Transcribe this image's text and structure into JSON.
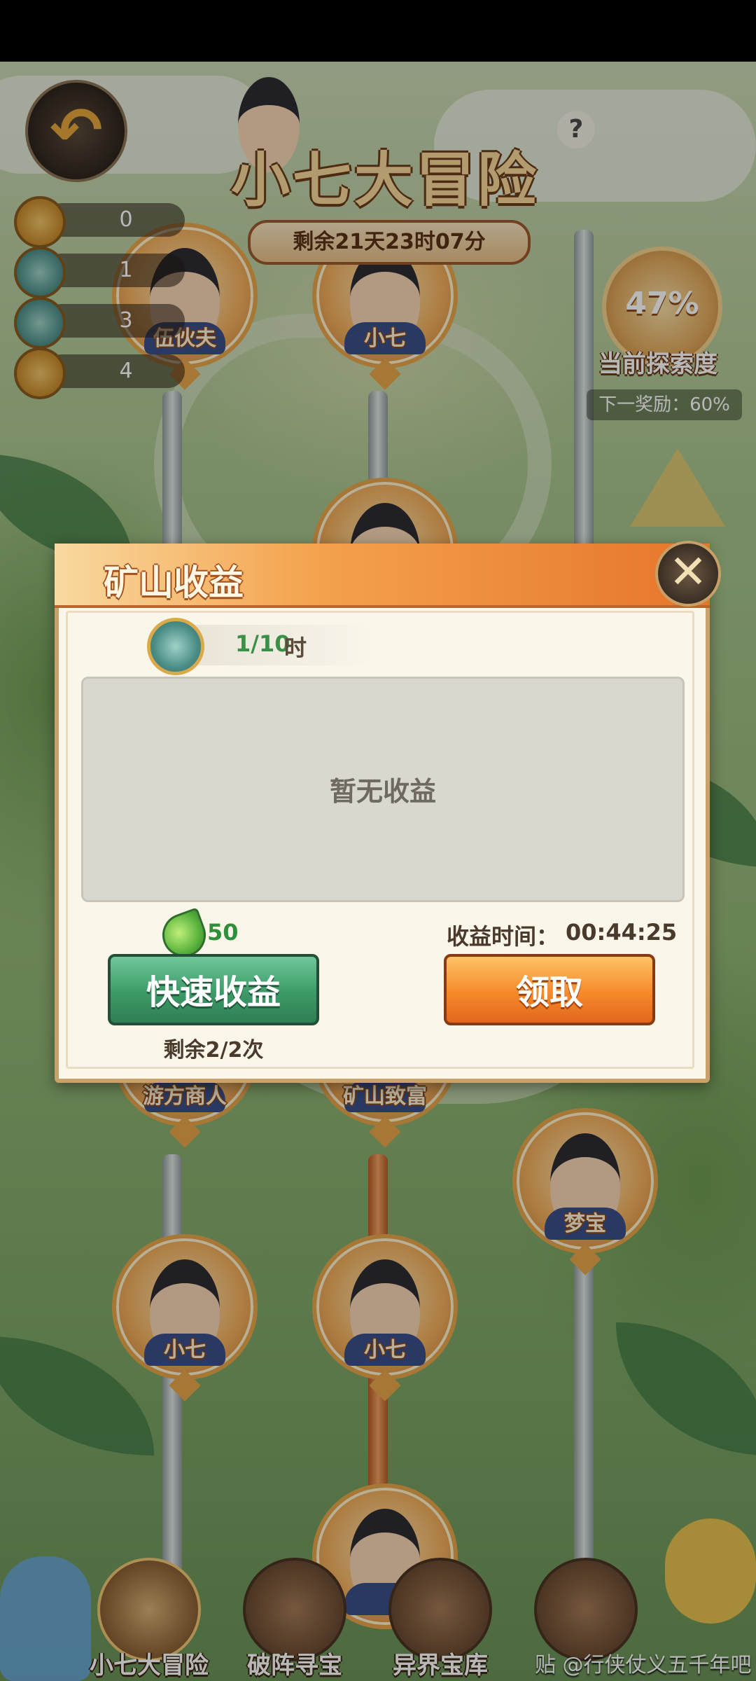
{
  "game": {
    "title": "小七大冒险",
    "timer": "剩余21天23时07分",
    "help_symbol": "?",
    "back_symbol": "↶"
  },
  "currencies": [
    {
      "icon": "phoenix-coin-icon",
      "value": "0"
    },
    {
      "icon": "dragon-coin-icon",
      "value": "1"
    },
    {
      "icon": "dragon-coin-icon",
      "value": "3"
    },
    {
      "icon": "swirl-coin-icon",
      "value": "4"
    }
  ],
  "exploration": {
    "percent": "47%",
    "label": "当前探索度",
    "next_reward": "下一奖励：60%"
  },
  "map_nodes": [
    {
      "label": "伍伙夫"
    },
    {
      "label": "小七"
    },
    {
      "label": ""
    },
    {
      "label": "游方商人"
    },
    {
      "label": "矿山致富"
    },
    {
      "label": "梦宝"
    },
    {
      "label": "小七"
    },
    {
      "label": "小七"
    },
    {
      "label": ""
    }
  ],
  "dialog": {
    "title": "矿山收益",
    "close_symbol": "✕",
    "hours_count": "1/10",
    "hours_unit": "时",
    "empty_text": "暂无收益",
    "cost_value": "50",
    "income_time_label": "收益时间：",
    "income_time_value": "00:44:25",
    "quick_button": "快速收益",
    "claim_button": "领取",
    "remaining": "剩余2/2次"
  },
  "bottom_nav": [
    {
      "label": "小七大冒险",
      "active": true
    },
    {
      "label": "破阵寻宝",
      "active": false
    },
    {
      "label": "异界宝库",
      "active": false
    },
    {
      "label": "",
      "active": false
    }
  ],
  "watermark": "贴 @行侠仗义五千年吧",
  "colors": {
    "accent_orange": "#f58a2a",
    "accent_green": "#3d9a68",
    "dialog_bg": "#fbf6ea"
  }
}
